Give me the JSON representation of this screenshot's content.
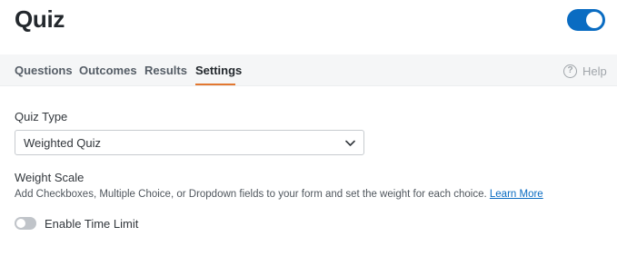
{
  "header": {
    "title": "Quiz",
    "toggle_on": true
  },
  "tabs": [
    {
      "label": "Questions",
      "active": false
    },
    {
      "label": "Outcomes",
      "active": false
    },
    {
      "label": "Results",
      "active": false
    },
    {
      "label": "Settings",
      "active": true
    }
  ],
  "help": {
    "icon": "question-circle-icon",
    "label": "Help"
  },
  "settings": {
    "quiz_type_label": "Quiz Type",
    "quiz_type_value": "Weighted Quiz",
    "weight_scale_label": "Weight Scale",
    "weight_scale_description": "Add Checkboxes, Multiple Choice, or Dropdown fields to your form and set the weight for each choice.",
    "learn_more_label": "Learn More",
    "time_limit_label": "Enable Time Limit",
    "time_limit_enabled": false
  },
  "colors": {
    "accent": "#0a6cc2",
    "tab_underline": "#e27730",
    "tab_bar_bg": "#f5f6f7"
  }
}
